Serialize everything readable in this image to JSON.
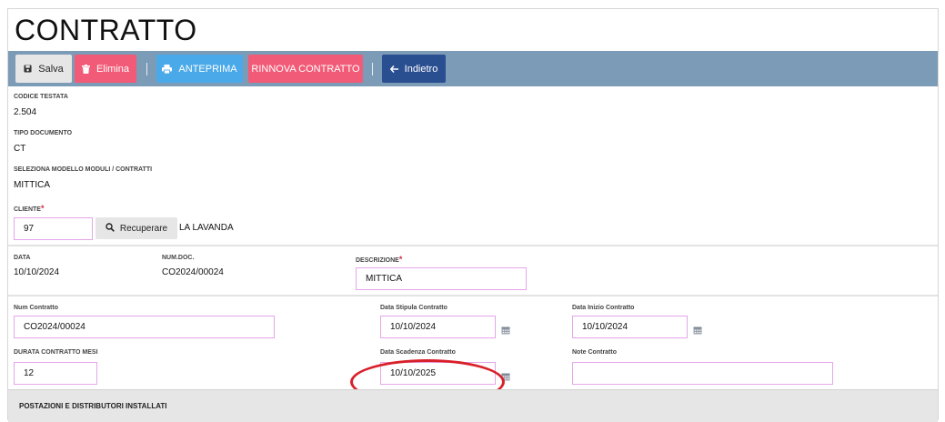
{
  "page": {
    "title": "CONTRATTO"
  },
  "toolbar": {
    "save_label": "Salva",
    "delete_label": "Elimina",
    "preview_label": "ANTEPRIMA",
    "renew_label": "RINNOVA CONTRATTO",
    "back_label": "Indietro"
  },
  "header": {
    "codice_testata": {
      "label": "CODICE TESTATA",
      "value": "2.504"
    },
    "tipo_documento": {
      "label": "TIPO DOCUMENTO",
      "value": "CT"
    },
    "modello": {
      "label": "SELEZIONA MODELLO MODULI / CONTRATTI",
      "value": "MITTICA"
    },
    "cliente": {
      "label": "CLIENTE",
      "required_mark": "*",
      "value": "97",
      "recover_label": "Recuperare",
      "name": "LA LAVANDA"
    }
  },
  "document": {
    "data": {
      "label": "DATA",
      "value": "10/10/2024"
    },
    "num_doc": {
      "label": "NUM.DOC.",
      "value": "CO2024/00024"
    },
    "descrizione": {
      "label": "DESCRIZIONE",
      "required_mark": "*",
      "value": "MITTICA"
    }
  },
  "contract": {
    "num_contratto": {
      "label": "Num Contratto",
      "value": "CO2024/00024"
    },
    "data_stipula": {
      "label": "Data Stipula Contratto",
      "value": "10/10/2024"
    },
    "data_inizio": {
      "label": "Data Inizio Contratto",
      "value": "10/10/2024"
    },
    "durata": {
      "label": "DURATA CONTRATTO MESI",
      "value": "12"
    },
    "data_scadenza": {
      "label": "Data Scadenza Contratto",
      "value": "10/10/2025"
    },
    "note": {
      "label": "Note Contratto",
      "value": ""
    }
  },
  "section": {
    "title": "POSTAZIONI E DISTRIBUTORI INSTALLATI"
  },
  "colors": {
    "toolbar_bg": "#7c9bb6",
    "danger": "#f25b77",
    "info": "#4aa9e9",
    "primary": "#2a4f91",
    "input_border": "#e5a5e9",
    "annotation": "#d8202a"
  },
  "icons": [
    "save-icon",
    "trash-icon",
    "print-icon",
    "arrow-left-icon",
    "search-icon",
    "calendar-icon"
  ]
}
